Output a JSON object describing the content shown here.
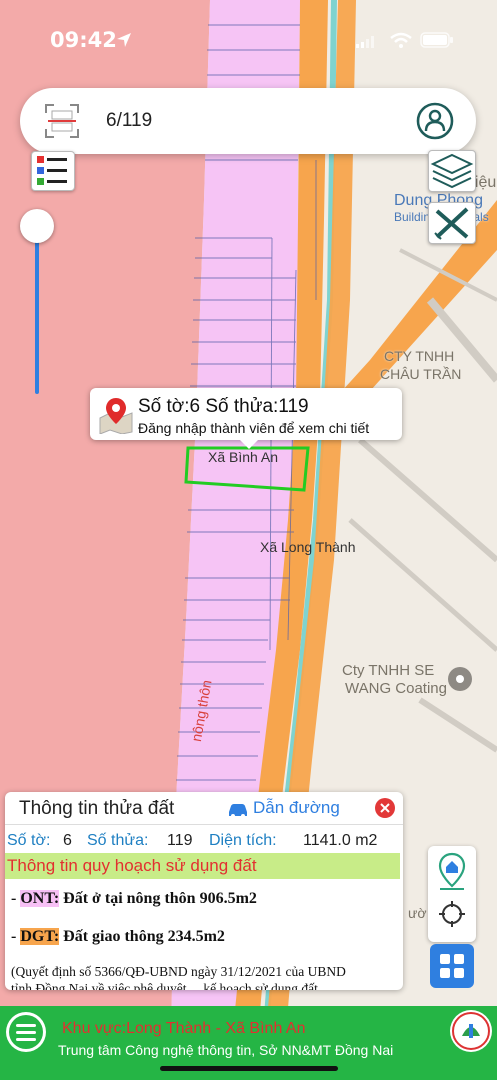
{
  "status_bar": {
    "time": "09:42",
    "signal": "●●●",
    "wifi": "wifi",
    "battery": "battery"
  },
  "search": {
    "value": "6/119",
    "scan_icon": "qr-scan-icon",
    "account_icon": "account-icon"
  },
  "map_labels": {
    "commune_binh_an": "Xã Bình An",
    "commune_long_thanh": "Xã Long Thành",
    "road_nong_thon": "nông thôn",
    "poi_lieu": "Liệu",
    "poi_dung_phong": "Dung Phong",
    "poi_building": "Building Materials",
    "poi_chau_tran_1": "CTY TNHH",
    "poi_chau_tran_2": "CHÂU TRẦN",
    "poi_se_1": "Cty TNHH SE",
    "poi_se_2": "WANG Coating",
    "poi_partial": "ườ"
  },
  "popup": {
    "title": "Số tờ:6 Số thửa:119",
    "subtitle": "Đăng nhập thành viên để xem chi tiết"
  },
  "panel": {
    "title": "Thông tin thửa đất",
    "directions_label": "Dẫn đường",
    "sheet_label": "Số tờ:",
    "sheet_value": "6",
    "parcel_label": "Số thửa:",
    "parcel_value": "119",
    "area_label": "Diện tích:",
    "area_value": "1141.0 m2",
    "planning_header": "Thông tin quy hoạch sử dụng đất",
    "ont_code": "ONT:",
    "ont_text": "Đất ở tại nông thôn 906.5m2",
    "dgt_code": "DGT:",
    "dgt_text": "Đất giao thông 234.5m2",
    "decision_line1": "(Quyết định số 5366/QĐ-UBND ngày 31/12/2021 của UBND",
    "decision_line2": "tỉnh Đồng Nai về việc phê duyệt ... kế hoạch sử dụng đất"
  },
  "bottom_bar": {
    "area_text": "Khu vực:Long Thành - Xã Bình An",
    "credit_text": "Trung tâm Công nghệ thông tin, Sở NN&MT Đồng Nai"
  },
  "slider": {
    "level": 0.0
  },
  "colors": {
    "residential": "#f3aaa9",
    "parcel": "#f6c4f5",
    "road": "#f7a54d",
    "water": "#7fd3cf",
    "selection": "#22cc22",
    "panel_highlight": "#c8ec88",
    "ont_bg": "#f7c0f5",
    "dgt_bg": "#f7a54d",
    "bottom_bar": "#25b545",
    "accent_blue": "#2f7fe0"
  }
}
